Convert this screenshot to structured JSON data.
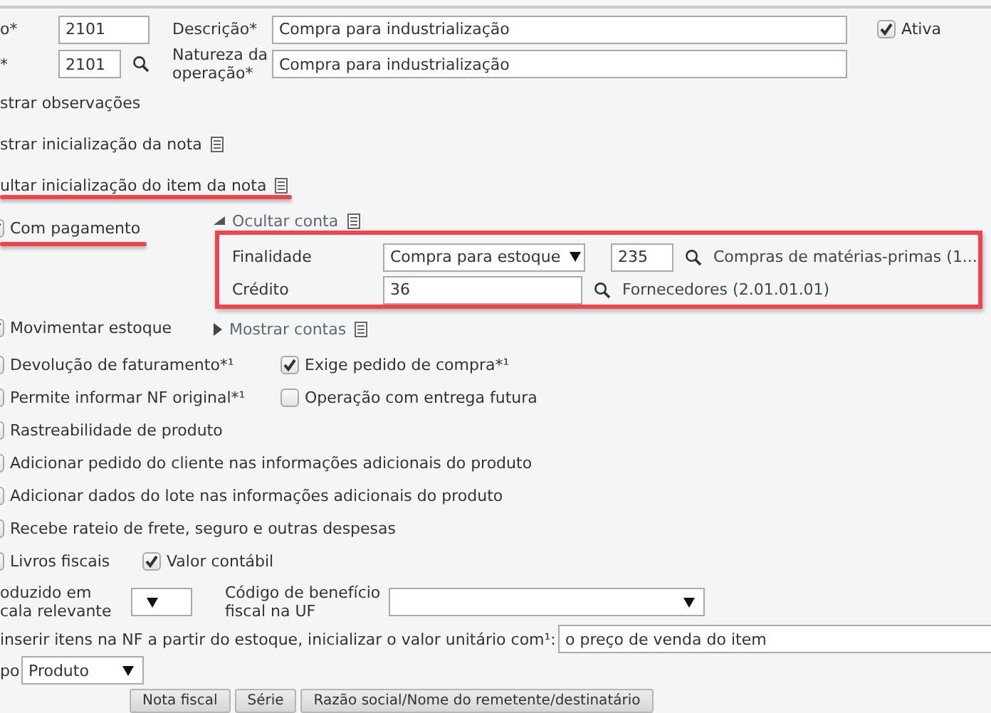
{
  "header": {
    "code_label": "o*",
    "code": "2101",
    "description_label": "Descrição*",
    "description": "Compra para industrialização",
    "active": {
      "label": "Ativa",
      "checked": true
    }
  },
  "nature": {
    "code_label": "*",
    "code": "2101",
    "label": "Natureza da\noperação*",
    "value": "Compra para industrialização"
  },
  "toggles": [
    {
      "label": "strar observações",
      "icon": false,
      "highlighted": false
    },
    {
      "label": "strar inicialização da nota",
      "icon": true,
      "highlighted": false
    },
    {
      "label": "ultar inicialização do item da nota",
      "icon": true,
      "highlighted": true
    }
  ],
  "payment": {
    "label": "Com pagamento",
    "checked": true,
    "highlighted": true
  },
  "accounts": {
    "toggle": "Ocultar conta",
    "expanded": true,
    "highlighted": true,
    "rows": [
      {
        "kind": "select-lookup",
        "label": "Finalidade",
        "value": "Compra para estoque",
        "code": "235",
        "description": "Compras de matérias-primas (1..."
      },
      {
        "kind": "lookup",
        "label": "Crédito",
        "code": "36",
        "description": "Fornecedores (2.01.01.01)"
      }
    ]
  },
  "stock": {
    "label": "Movimentar estoque",
    "checked": true
  },
  "more_accounts": {
    "toggle": "Mostrar contas",
    "expanded": false
  },
  "option_rows": [
    [
      {
        "label": "Devolução de faturamento*¹",
        "checked": false
      },
      {
        "label": "Exige pedido de compra*¹",
        "checked": true
      }
    ],
    [
      {
        "label": "Permite informar NF original*¹",
        "checked": false
      },
      {
        "label": "Operação com entrega futura",
        "checked": false
      }
    ],
    [
      {
        "label": "Rastreabilidade de produto",
        "checked": false
      }
    ],
    [
      {
        "label": "Adicionar pedido do cliente nas informações adicionais do produto",
        "checked": false
      }
    ],
    [
      {
        "label": "Adicionar dados do lote nas informações adicionais do produto",
        "checked": false
      }
    ],
    [
      {
        "label": "Recebe rateio de frete, seguro e outras despesas",
        "checked": false
      }
    ]
  ],
  "ledger_options": [
    {
      "label": "Livros fiscais",
      "checked": false
    },
    {
      "label": "Valor contábil",
      "checked": true
    }
  ],
  "fiscal": {
    "scale_label": "oduzido em\ncala relevante",
    "benefit_label": "Código de benefício\nfiscal na UF"
  },
  "unit_value": {
    "label": "inserir itens na NF a partir do estoque, inicializar o valor unitário com¹:",
    "value": "o preço de venda do item"
  },
  "type": {
    "label": "po",
    "value": "Produto"
  },
  "buttons": [
    "Nota fiscal",
    "Série",
    "Razão social/Nome do remetente/destinatário"
  ]
}
